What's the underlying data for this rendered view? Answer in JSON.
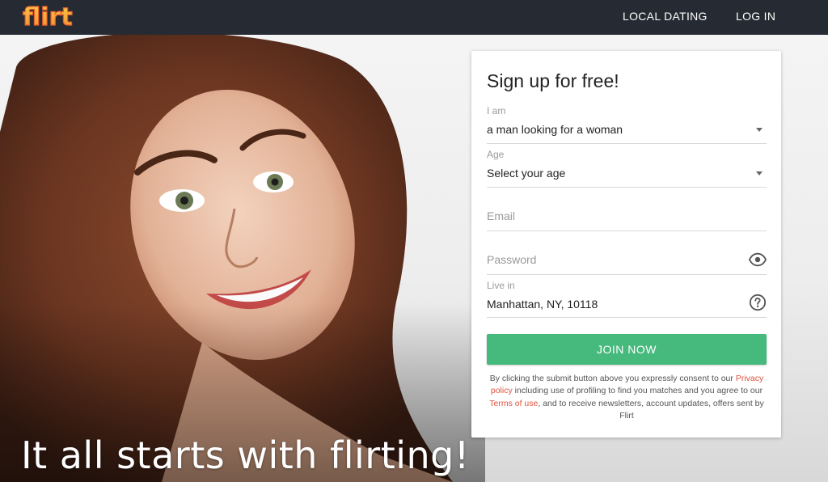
{
  "header": {
    "logo_text": "flirt",
    "nav": {
      "local_dating": "LOCAL DATING",
      "log_in": "LOG IN"
    }
  },
  "hero": {
    "tagline": "It all starts with flirting!"
  },
  "signup": {
    "title": "Sign up for free!",
    "iam": {
      "label": "I am",
      "value": "a man looking for a woman"
    },
    "age": {
      "label": "Age",
      "value": "Select your age"
    },
    "email": {
      "placeholder": "Email"
    },
    "password": {
      "placeholder": "Password"
    },
    "live_in": {
      "label": "Live in",
      "value": "Manhattan, NY, 10118"
    },
    "join_label": "JOIN NOW",
    "legal": {
      "part1": "By clicking the submit button above you expressly consent to our ",
      "privacy_link": "Privacy policy",
      "part2": " including use of profiling to find you matches and you agree to our ",
      "terms_link": "Terms of use",
      "part3": ", and to receive newsletters, account updates, offers sent by Flirt"
    }
  },
  "colors": {
    "topbar": "#262a33",
    "accent_green": "#46b97d",
    "link_red": "#e0533f",
    "logo_orange": "#f7a23a"
  },
  "icons": {
    "logo": "flirt-logo",
    "caret": "caret-down-icon",
    "eye": "eye-icon",
    "help": "question-circle-icon"
  }
}
